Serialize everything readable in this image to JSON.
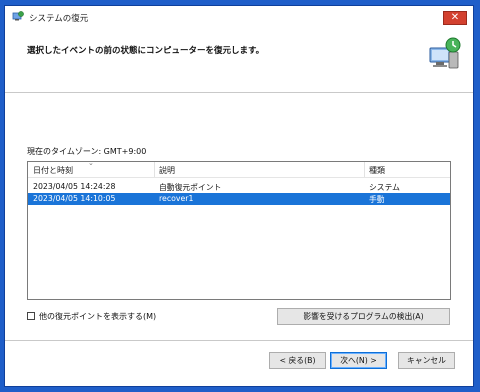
{
  "window": {
    "title": "システムの復元"
  },
  "header": {
    "description": "選択したイベントの前の状態にコンピューターを復元します。"
  },
  "timezone_label": "現在のタイムゾーン: GMT+9:00",
  "table": {
    "columns": [
      "日付と時刻",
      "説明",
      "種類"
    ],
    "rows": [
      {
        "date": "2023/04/05 14:24:28",
        "description": "自動復元ポイント",
        "type": "システム",
        "selected": false
      },
      {
        "date": "2023/04/05 14:10:05",
        "description": "recover1",
        "type": "手動",
        "selected": true
      }
    ]
  },
  "show_more": {
    "label": "他の復元ポイントを表示する(M)",
    "checked": false
  },
  "scan_button": "影響を受けるプログラムの検出(A)",
  "nav": {
    "back": "< 戻る(B)",
    "next": "次へ(N) >",
    "cancel": "キャンセル"
  },
  "colors": {
    "selection": "#1a74d8",
    "desktop": "#1f5ec9",
    "close": "#d3412f"
  },
  "icons": {
    "title": "system-restore-icon",
    "header": "restore-computer-icon",
    "close": "close-icon"
  }
}
